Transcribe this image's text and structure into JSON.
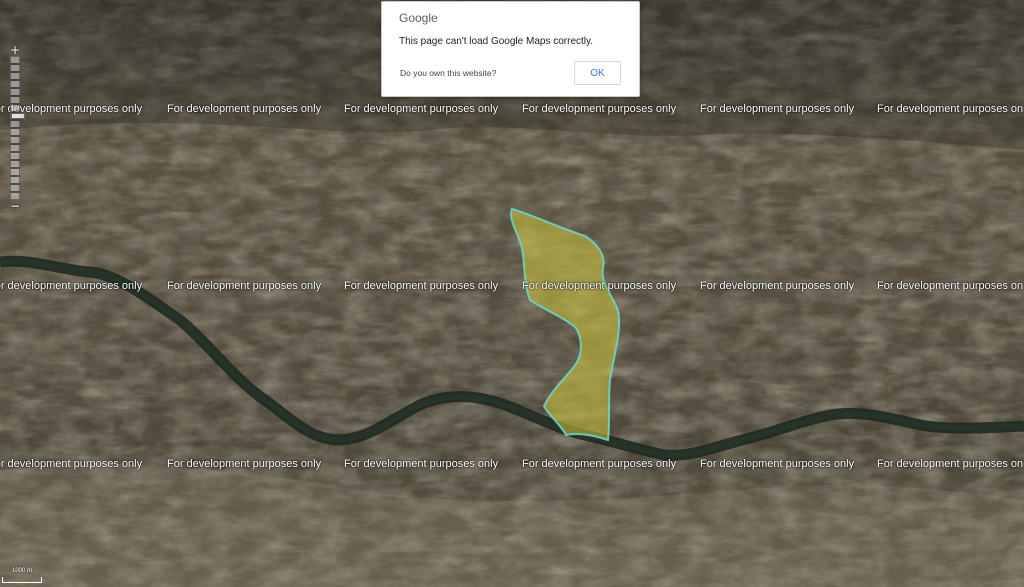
{
  "watermark": {
    "text": "For development purposes only"
  },
  "dialog": {
    "logo": "Google",
    "message": "This page can't load Google Maps correctly.",
    "link": "Do you own this website?",
    "ok_label": "OK"
  },
  "zoom": {
    "in_label": "+",
    "out_label": "−"
  },
  "scale": {
    "label": "1000 m"
  },
  "map": {
    "type": "satellite",
    "polygon_fill": "#c9c13c",
    "polygon_stroke": "#6fd4c0",
    "river_color": "#1f2a20"
  }
}
